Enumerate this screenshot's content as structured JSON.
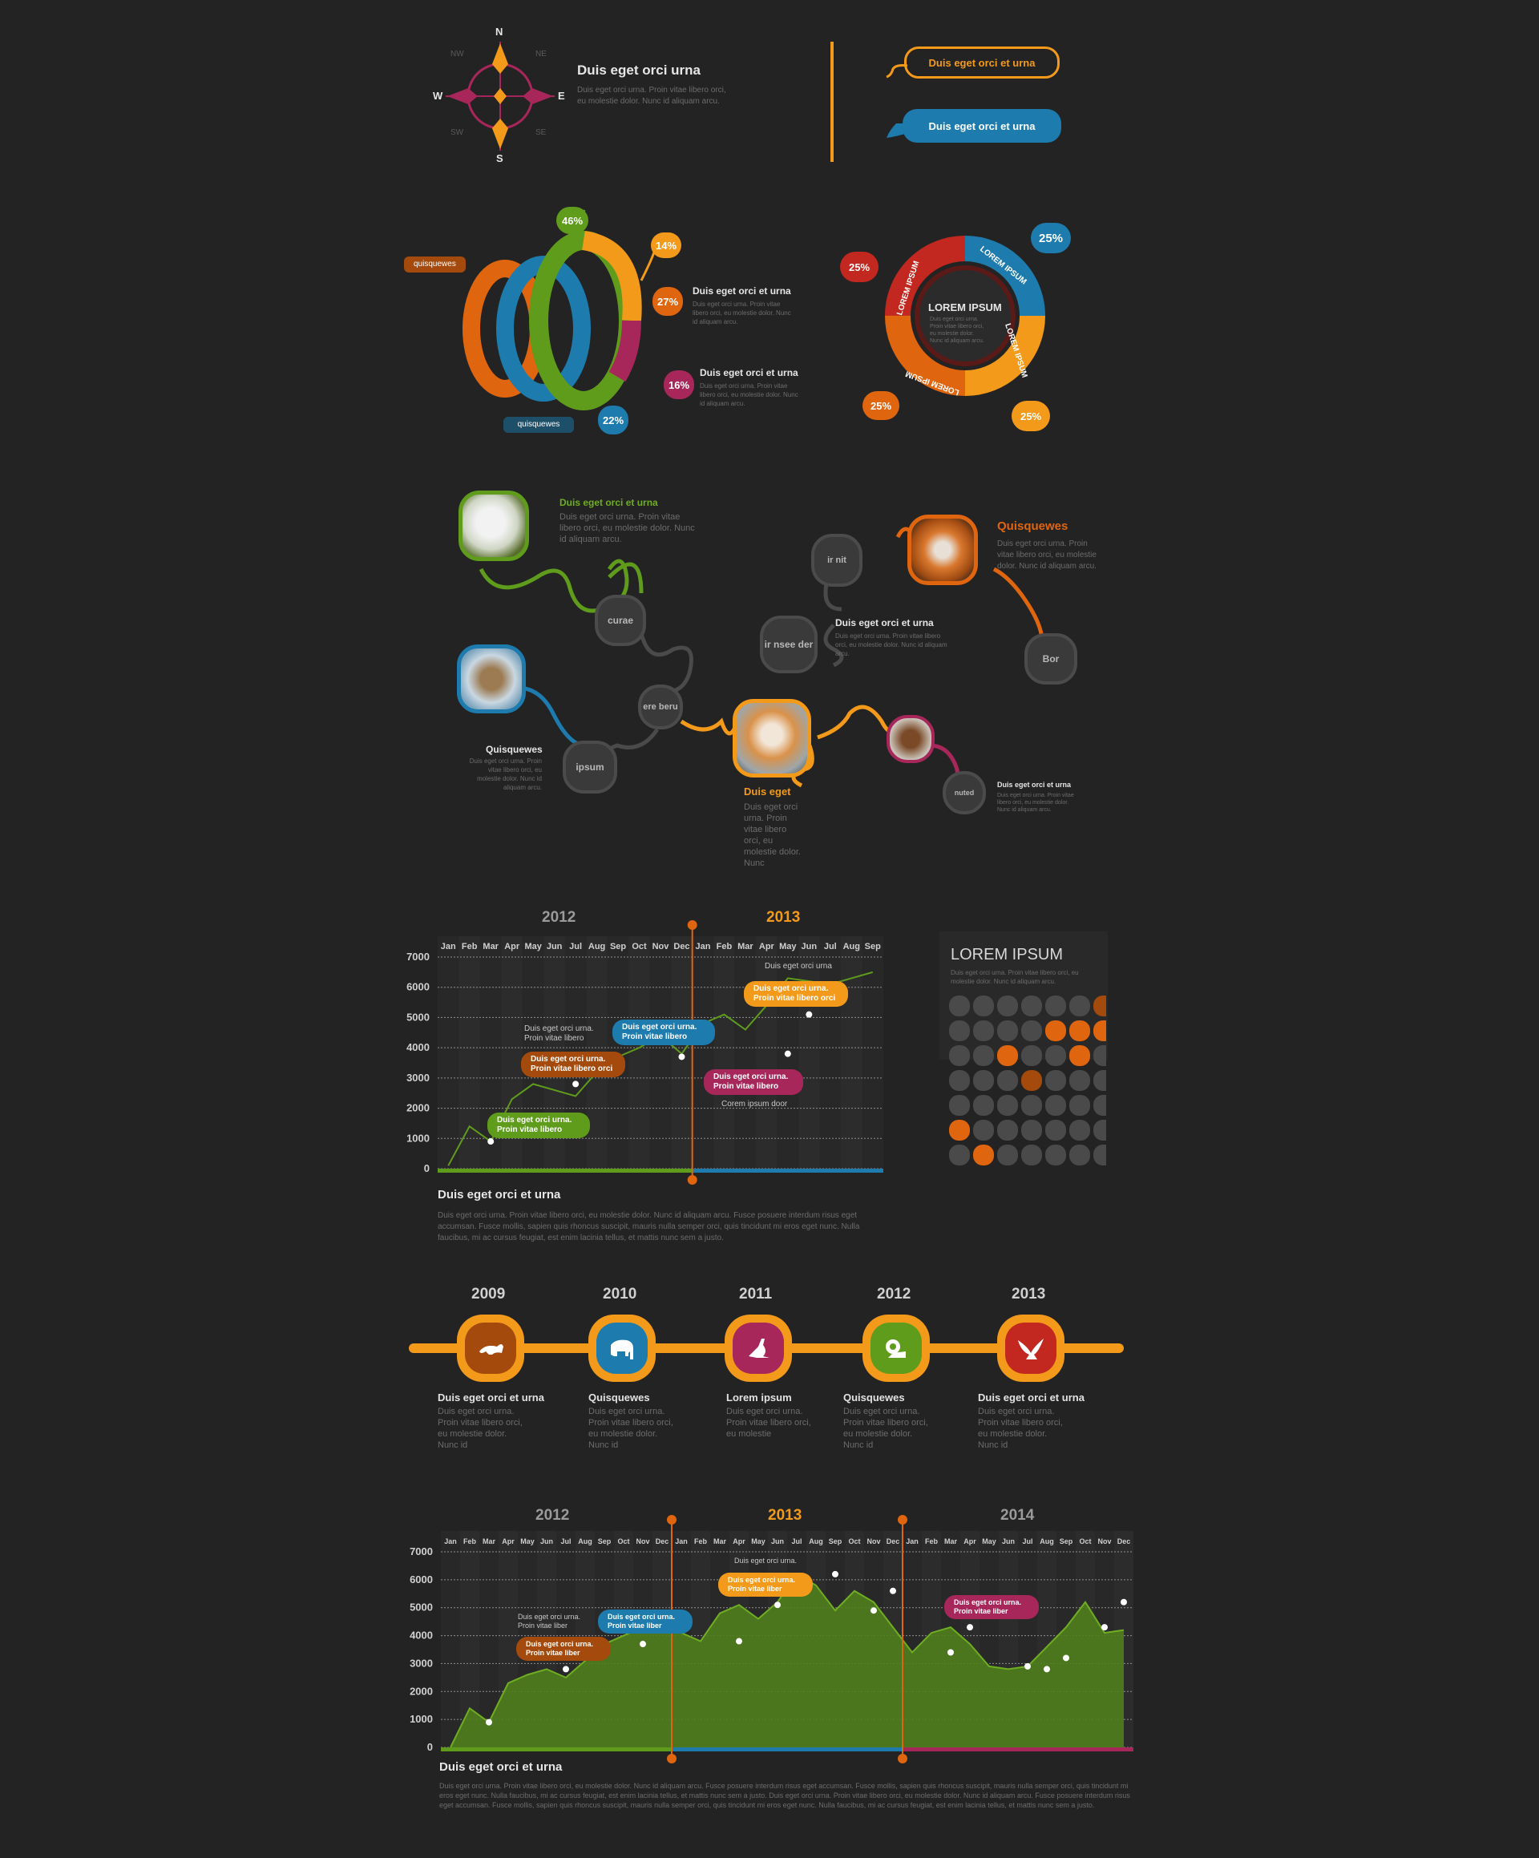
{
  "colors": {
    "orange": "#f39a1a",
    "dark_orange": "#e0650f",
    "green": "#5f9c1c",
    "blue": "#1d7bad",
    "magenta": "#a8275a",
    "red": "#c2281f",
    "brown": "#a44a0c",
    "bg": "#232323"
  },
  "compass": {
    "n": "N",
    "s": "S",
    "e": "E",
    "w": "W",
    "ne": "NE",
    "nw": "NW",
    "se": "SE",
    "sw": "SW",
    "title": "Duis eget orci urna",
    "text": "Duis eget orci urna. Proin vitae libero orci, eu molestie dolor. Nunc id aliquam arcu."
  },
  "callouts": {
    "outline": "Duis eget orci et urna",
    "filled": "Duis eget orci et urna"
  },
  "rings": {
    "pcts": {
      "green": "46%",
      "orange_top": "14%",
      "orange": "27%",
      "magenta": "16%",
      "blue": "22%"
    },
    "label_top": "quisquewes",
    "label_bottom": "quisquewes",
    "item1": {
      "title": "Duis eget orci et urna",
      "text": "Duis eget orci urna. Proin vitae libero orci, eu molestie dolor. Nunc id aliquam arcu."
    },
    "item2": {
      "title": "Duis eget orci et urna",
      "text": "Duis eget orci urna. Proin vitae libero orci, eu molestie dolor. Nunc id aliquam arcu."
    }
  },
  "cycle": {
    "center_title": "LOREM IPSUM",
    "center_text": "Duis eget orci urna. Proin vitae libero orci, eu molestie dolor. Nunc id aliquam arcu.",
    "seg_label": "LOREM IPSUM",
    "p1": "25%",
    "p2": "25%",
    "p3": "25%",
    "p4": "25%"
  },
  "network": {
    "rabbit": {
      "title": "Duis eget orci et urna",
      "text": "Duis eget orci urna. Proin vitae libero orci, eu molestie dolor. Nunc id aliquam arcu."
    },
    "fox": {
      "title": "Quisquewes",
      "text": "Duis eget orci urna. Proin vitae libero orci, eu molestie dolor. Nunc id aliquam arcu."
    },
    "middle": {
      "title": "Duis eget orci et urna",
      "text": "Duis eget orci urna. Proin vitae libero orci, eu molestie dolor. Nunc id aliquam arcu."
    },
    "squirrel": {
      "title": "Quisquewes",
      "text": "Duis eget orci urna. Proin vitae libero orci, eu molestie dolor. Nunc id aliquam arcu."
    },
    "dog": {
      "title": "Duis eget",
      "text": "Duis eget orci urna. Proin vitae libero orci, eu molestie dolor. Nunc"
    },
    "hamster": {
      "title": "Duis eget orci et urna",
      "text": "Duis eget orci urna. Proin vitae libero orci, eu molestie dolor. Nunc id aliquam arcu."
    },
    "nodes": {
      "curae": "curae",
      "ere": "ere beru",
      "ipsum": "ipsum",
      "irnit": "ir nit",
      "irnsee": "ir nsee der",
      "bor": "Bor",
      "nuted": "nuted"
    }
  },
  "chart1_text": {
    "tag_top_label": "Duis eget orci urna",
    "tag_orange": "Duis eget orci urna. Proin vitae libero orci",
    "tag_blue": "Duis eget orci urna. Proin vitae libero",
    "tag_gray": "Duis eget orci urna. Proin vitae libero",
    "tag_brown": "Duis eget orci urna. Proin vitae libero orci",
    "tag_red": "Duis eget orci urna. Proin vitae libero",
    "tag_red_below": "Corem ipsum door",
    "tag_green": "Duis eget orci urna. Proin vitae libero",
    "caption_title": "Duis eget orci et urna",
    "caption_text": "Duis eget orci urna. Proin vitae libero orci, eu molestie dolor. Nunc id aliquam arcu. Fusce posuere interdum risus eget accumsan. Fusce mollis, sapien quis rhoncus suscipit, mauris nulla semper orci, quis tincidunt mi eros eget nunc. Nulla faucibus, mi ac cursus feugiat, est enim lacinia tellus, et mattis nunc sem a justo."
  },
  "dots_panel": {
    "title": "LOREM IPSUM",
    "text": "Duis eget orci urna. Proin vitae libero orci, eu molestie dolor. Nunc id aliquam arcu."
  },
  "timeline": {
    "items": [
      {
        "year": "2009",
        "title": "Duis eget orci et urna",
        "text": "Duis eget orci urna. Proin vitae libero orci, eu molestie dolor. Nunc id",
        "color": "#a44a0c",
        "icon": "tiger-icon"
      },
      {
        "year": "2010",
        "title": "Quisquewes",
        "text": "Duis eget orci urna. Proin vitae libero orci, eu molestie dolor. Nunc id",
        "color": "#1d7bad",
        "icon": "elephant-icon"
      },
      {
        "year": "2011",
        "title": "Lorem ipsum",
        "text": "Duis eget orci urna. Proin vitae libero orci, eu molestie",
        "color": "#a8275a",
        "icon": "kangaroo-icon"
      },
      {
        "year": "2012",
        "title": "Quisquewes",
        "text": "Duis eget orci urna. Proin vitae libero orci, eu molestie dolor. Nunc id",
        "color": "#5f9c1c",
        "icon": "lion-icon"
      },
      {
        "year": "2013",
        "title": "Duis eget orci et urna",
        "text": "Duis eget orci urna. Proin vitae libero orci, eu molestie dolor. Nunc id",
        "color": "#c2281f",
        "icon": "eagle-icon"
      }
    ]
  },
  "chart2_text": {
    "tag_top_label": "Duis eget orci urna.",
    "tag_orange": "Duis eget orci urna. Proin vitae liber",
    "tag_blue": "Duis eget orci urna. Proin vitae liber",
    "tag_gray": "Duis eget orci urna. Proin vitae liber",
    "tag_brown": "Duis eget orci urna. Proin vitae liber",
    "tag_red": "Duis eget orci urna. Proin vitae liber",
    "caption_title": "Duis eget orci et urna",
    "caption_text": "Duis eget orci urna. Proin vitae libero orci, eu molestie dolor. Nunc id aliquam arcu. Fusce posuere interdum risus eget accumsan. Fusce mollis, sapien quis rhoncus suscipit, mauris nulla semper orci, quis tincidunt mi eros eget nunc. Nulla faucibus, mi ac cursus feugiat, est enim lacinia tellus, et mattis nunc sem a justo. Duis eget orci urna. Proin vitae libero orci, eu molestie dolor. Nunc id aliquam arcu. Fusce posuere interdum risus eget accumsan. Fusce mollis, sapien quis rhoncus suscipit, mauris nulla semper orci, quis tincidunt mi eros eget nunc. Nulla faucibus, mi ac cursus feugiat, est enim lacinia tellus, et mattis nunc sem a justo."
  },
  "chart_data": [
    {
      "type": "line",
      "years": [
        "2012",
        "2013"
      ],
      "categories": [
        "Jan",
        "Feb",
        "Mar",
        "Apr",
        "May",
        "Jun",
        "Jul",
        "Aug",
        "Sep",
        "Oct",
        "Nov",
        "Dec",
        "Jan",
        "Feb",
        "Mar",
        "Apr",
        "May",
        "Jun",
        "Jul",
        "Aug",
        "Sep"
      ],
      "yticks": [
        "0",
        "1000",
        "2000",
        "3000",
        "4000",
        "5000",
        "6000",
        "7000"
      ],
      "ylim": [
        0,
        7000
      ],
      "series": [
        {
          "values": [
            100,
            1400,
            900,
            2300,
            2800,
            2600,
            2400,
            3200,
            3700,
            4000,
            4400,
            3800,
            4800,
            5100,
            4600,
            5400,
            6300,
            6200,
            6100,
            6300,
            6500
          ]
        }
      ],
      "highlighted_points": [
        [
          2,
          900
        ],
        [
          6,
          2800
        ],
        [
          11,
          3700
        ],
        [
          16,
          3800
        ],
        [
          17,
          5100
        ]
      ],
      "colors": {
        "line": "#5f9c1c",
        "divider": "#e0650f",
        "bar_2012": "#5f9c1c",
        "bar_2013": "#1d7bad"
      }
    },
    {
      "type": "area",
      "years": [
        "2012",
        "2013",
        "2014"
      ],
      "categories": [
        "Jan",
        "Feb",
        "Mar",
        "Apr",
        "May",
        "Jun",
        "Jul",
        "Aug",
        "Sep",
        "Oct",
        "Nov",
        "Dec",
        "Jan",
        "Feb",
        "Mar",
        "Apr",
        "May",
        "Jun",
        "Jul",
        "Aug",
        "Sep",
        "Oct",
        "Nov",
        "Dec",
        "Jan",
        "Feb",
        "Mar",
        "Apr",
        "May",
        "Jun",
        "Jul",
        "Aug",
        "Sep",
        "Oct",
        "Nov",
        "Dec"
      ],
      "yticks": [
        "0",
        "1000",
        "2000",
        "3000",
        "4000",
        "5000",
        "6000",
        "7000"
      ],
      "ylim": [
        0,
        7000
      ],
      "series": [
        {
          "values": [
            0,
            1400,
            900,
            2300,
            2600,
            2800,
            2500,
            3100,
            3700,
            4000,
            4300,
            4400,
            4100,
            3800,
            4800,
            5100,
            4600,
            5200,
            6200,
            5800,
            4900,
            5600,
            5200,
            4300,
            3400,
            4100,
            4300,
            3700,
            2900,
            2800,
            2900,
            3600,
            4300,
            5200,
            4100,
            4200
          ]
        }
      ],
      "highlighted_points": [
        [
          2,
          900
        ],
        [
          6,
          2800
        ],
        [
          10,
          3700
        ],
        [
          15,
          3800
        ],
        [
          17,
          5100
        ],
        [
          20,
          6200
        ],
        [
          22,
          4900
        ],
        [
          23,
          5600
        ],
        [
          26,
          3400
        ],
        [
          27,
          4300
        ],
        [
          30,
          2900
        ],
        [
          31,
          2800
        ],
        [
          32,
          3200
        ],
        [
          34,
          4300
        ],
        [
          35,
          5200
        ],
        [
          36,
          4100
        ]
      ],
      "colors": {
        "area": "#4f7e1c",
        "line": "#6fae23",
        "divider": "#e0650f",
        "bar_2012": "#5f9c1c",
        "bar_2013": "#1d7bad",
        "bar_2014": "#a8275a"
      }
    }
  ]
}
